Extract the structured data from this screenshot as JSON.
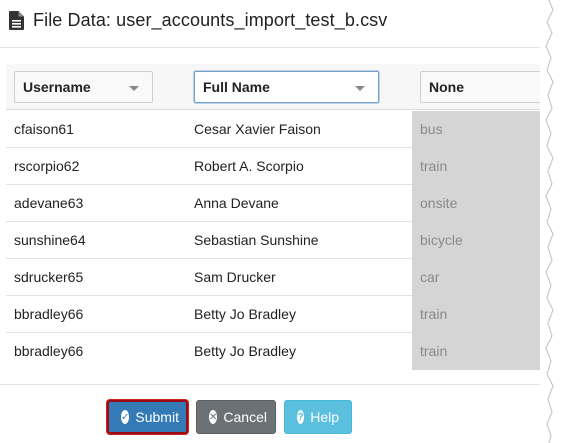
{
  "dialog": {
    "title": "File Data: user_accounts_import_test_b.csv",
    "icon": "document-icon"
  },
  "columns": {
    "username_select": "Username",
    "fullname_select": "Full Name",
    "none_select": "None"
  },
  "rows": [
    {
      "username": "cfaison61",
      "full_name": "Cesar Xavier Faison",
      "extra": "bus"
    },
    {
      "username": "rscorpio62",
      "full_name": "Robert A. Scorpio",
      "extra": "train"
    },
    {
      "username": "adevane63",
      "full_name": "Anna Devane",
      "extra": "onsite"
    },
    {
      "username": "sunshine64",
      "full_name": "Sebastian Sunshine",
      "extra": "bicycle"
    },
    {
      "username": "sdrucker65",
      "full_name": "Sam Drucker",
      "extra": "car"
    },
    {
      "username": "bbradley66",
      "full_name": "Betty Jo Bradley",
      "extra": "train"
    },
    {
      "username": "bbradley66",
      "full_name": "Betty Jo Bradley",
      "extra": "train"
    }
  ],
  "buttons": {
    "submit": "Submit",
    "cancel": "Cancel",
    "help": "Help"
  },
  "colors": {
    "primary": "#337ab7",
    "secondary": "#6b7175",
    "info": "#5bc0de",
    "focus_outline": "#9b0d14",
    "ignored_column_bg": "#d5d5d5"
  }
}
